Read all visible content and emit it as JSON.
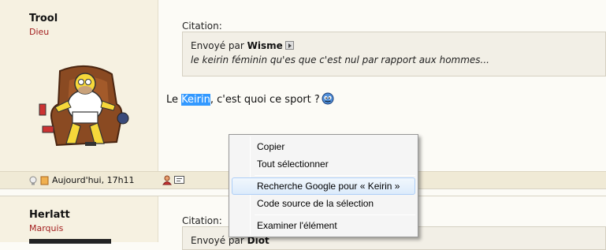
{
  "posts": [
    {
      "username": "Trool",
      "rank": "Dieu",
      "timestamp": "Aujourd'hui, 17h11",
      "quote": {
        "label": "Citation:",
        "sent_by": "Envoyé par",
        "author": "Wisme",
        "text": "le keirin féminin qu'es que c'est nul par rapport aux hommes..."
      },
      "message": {
        "before": "Le ",
        "selected": "Keirin",
        "after": ", c'est quoi ce sport ?"
      }
    },
    {
      "username": "Herlatt",
      "rank": "Marquis",
      "quote": {
        "label": "Citation:",
        "sent_by": "Envoyé par",
        "author": "Diot"
      }
    }
  ],
  "context_menu": {
    "items": [
      {
        "label": "Copier"
      },
      {
        "label": "Tout sélectionner"
      },
      {
        "label": "Recherche Google pour « Keirin »"
      },
      {
        "label": "Code source de la sélection"
      },
      {
        "label": "Examiner l'élément"
      }
    ],
    "highlighted_index": 2
  },
  "colors": {
    "rank": "#a31f1f",
    "selection": "#3399ff",
    "menu_highlight": "#dcebfb"
  }
}
